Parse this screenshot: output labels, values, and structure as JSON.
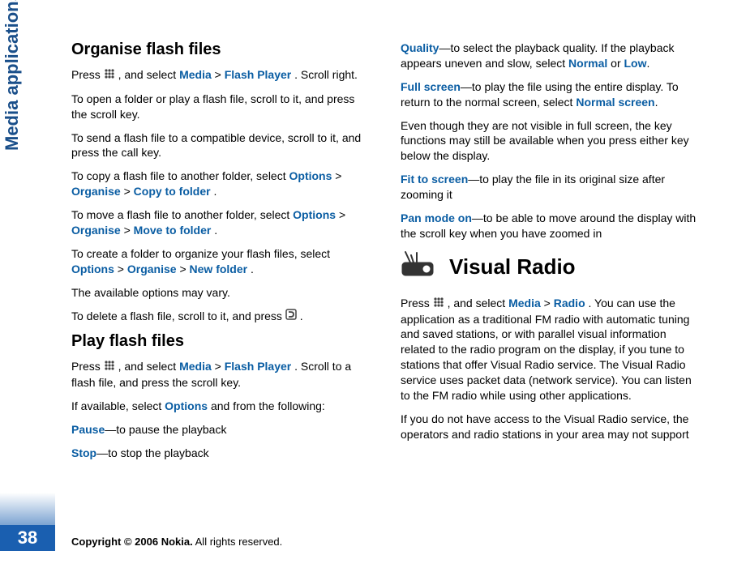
{
  "sidebar": {
    "section_label": "Media applications",
    "page_number": "38"
  },
  "footer": {
    "copyright_bold": "Copyright © 2006 Nokia.",
    "copyright_rest": " All rights reserved."
  },
  "headings": {
    "organise": "Organise flash files",
    "play": "Play flash files",
    "visual_radio": "Visual Radio"
  },
  "links": {
    "media": "Media",
    "flash_player": "Flash Player",
    "options": "Options",
    "organise": "Organise",
    "copy_to_folder": "Copy to folder",
    "move_to_folder": "Move to folder",
    "new_folder": "New folder",
    "normal": "Normal",
    "low": "Low",
    "normal_screen": "Normal screen",
    "radio": "Radio",
    "pause": "Pause",
    "stop": "Stop",
    "quality": "Quality",
    "full_screen": "Full screen",
    "fit_to_screen": "Fit to screen",
    "pan_mode_on": "Pan mode on"
  },
  "text": {
    "p1_a": "Press ",
    "p1_b": " , and select ",
    "p1_c": " > ",
    "p1_d": ". Scroll right.",
    "p2": "To open a folder or play a flash file, scroll to it, and press the scroll key.",
    "p3": "To send a flash file to a compatible device, scroll to it, and press the call key.",
    "p4_a": "To copy a flash file to another folder, select ",
    "p4_b": " > ",
    "p4_c": " > ",
    "p4_d": ".",
    "p5_a": "To move a flash file to another folder, select ",
    "p5_b": " > ",
    "p5_c": " > ",
    "p5_d": ".",
    "p6_a": "To create a folder to organize your flash files, select ",
    "p6_b": " >",
    "p6_c": " > ",
    "p6_d": ".",
    "p7": "The available options may vary.",
    "p8_a": "To delete a flash file, scroll to it, and press ",
    "p8_b": " .",
    "p9_a": "Press ",
    "p9_b": " , and select ",
    "p9_c": " >",
    "p9_d": ". Scroll to a flash file, and press the scroll key.",
    "p10_a": "If available, select ",
    "p10_b": " and from the following:",
    "p11": "—to pause the playback",
    "p12": "—to stop the playback",
    "q_a": "—to select the playback quality. If the playback appears uneven and slow, select ",
    "q_b": " or ",
    "q_c": ".",
    "fs_a": "—to play the file using the entire display. To return to the normal screen, select ",
    "fs_b": ".",
    "fs_note": "Even though they are not visible in full screen, the key functions may still be available when you press either key below the display.",
    "fit": "—to play the file in its original size after zooming it",
    "pan": "—to be able to move around the display with the scroll key when you have zoomed in",
    "vr_a": "Press ",
    "vr_b": " , and select ",
    "vr_c": " > ",
    "vr_d": ". You can use the application as a traditional FM radio with automatic tuning and saved stations, or with parallel visual information related to the radio program on the display, if you tune to stations that offer Visual Radio service. The Visual Radio service uses packet data (network service). You can listen to the FM radio while using other applications.",
    "vr2": "If you do not have access to the Visual Radio service, the operators and radio stations in your area may not support"
  }
}
